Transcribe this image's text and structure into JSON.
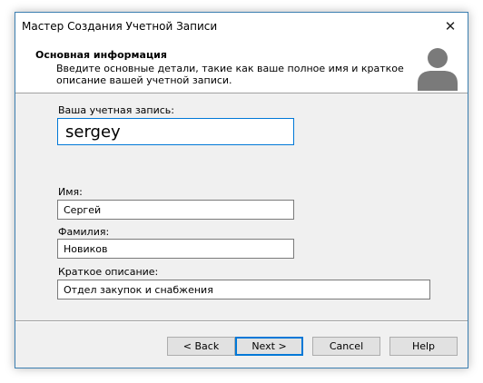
{
  "window": {
    "title": "Мастер Создания Учетной Записи"
  },
  "header": {
    "title": "Основная информация",
    "description": "Введите основные детали, такие как ваше полное имя и краткое описание вашей учетной записи."
  },
  "icons": {
    "close": "close-icon",
    "avatar": "user-avatar-icon"
  },
  "form": {
    "account": {
      "label": "Ваша учетная запись:",
      "value": "sergey"
    },
    "first_name": {
      "label": "Имя:",
      "value": "Сергей"
    },
    "last_name": {
      "label": "Фамилия:",
      "value": "Новиков"
    },
    "description": {
      "label": "Краткое описание:",
      "value": "Отдел закупок и снабжения"
    }
  },
  "buttons": {
    "back": "< Back",
    "next": "Next >",
    "cancel": "Cancel",
    "help": "Help"
  },
  "colors": {
    "accent": "#0078d7",
    "avatar": "#7a7a7a",
    "dialog_bg": "#f0f0f0"
  }
}
